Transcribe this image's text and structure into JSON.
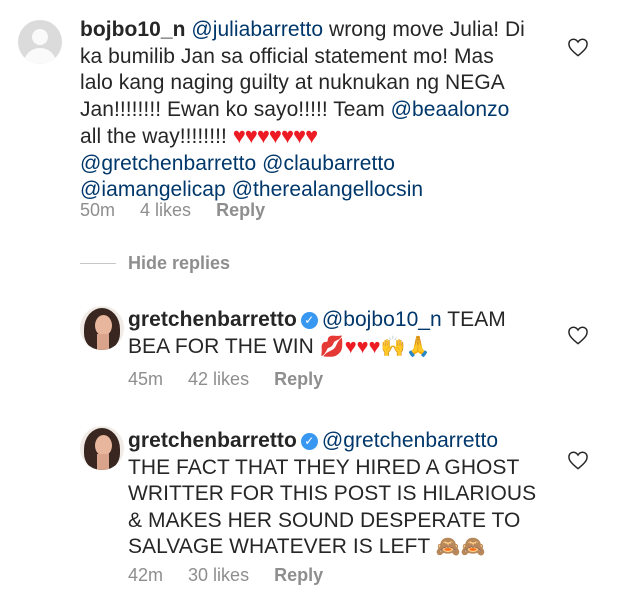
{
  "comment1": {
    "username": "bojbo10_n",
    "mention": "@juliabarretto",
    "text_a": " wrong move Julia! Di",
    "line2": "ka bumilib Jan sa official statement mo! Mas",
    "line3": "lalo kang naging guilty at nuknukan ng NEGA",
    "line4_text": "Jan!!!!!!!! Ewan ko sayo!!!!! Team ",
    "line4_mention": "@beaalonzo",
    "line5_text": "all the way!!!!!!!! ",
    "hearts": "♥♥♥♥♥♥♥",
    "line6": "@gretchenbarretto @claubarretto",
    "line7": "@iamangelicap @therealangellocsin",
    "time": "50m",
    "likes": "4 likes",
    "reply": "Reply"
  },
  "hide_replies": "Hide replies",
  "reply1": {
    "username": "gretchenbarretto",
    "mention": "@bojbo10_n",
    "text_a": " TEAM",
    "line2_text": "BEA FOR THE WIN ",
    "emoji": "💋♥♥♥🙌🙏",
    "time": "45m",
    "likes": "42 likes",
    "reply": "Reply"
  },
  "reply2": {
    "username": "gretchenbarretto",
    "mention": "@gretchenbarretto",
    "line2": "THE FACT THAT THEY HIRED A GHOST",
    "line3": "WRITTER FOR THIS POST IS HILARIOUS",
    "line4": "& MAKES HER SOUND DESPERATE TO",
    "line5_text": "SALVAGE WHATEVER IS LEFT ",
    "emoji": "🙈🙈",
    "time": "42m",
    "likes": "30 likes",
    "reply": "Reply"
  },
  "icons": {
    "like": "heart-outline-icon",
    "verified": "verified-badge-icon",
    "avatar_default": "default-avatar-icon"
  },
  "colors": {
    "mention": "#00376b",
    "meta": "#8e8e8e",
    "heart_emoji": "#ed1c24",
    "verified": "#3897f0"
  }
}
